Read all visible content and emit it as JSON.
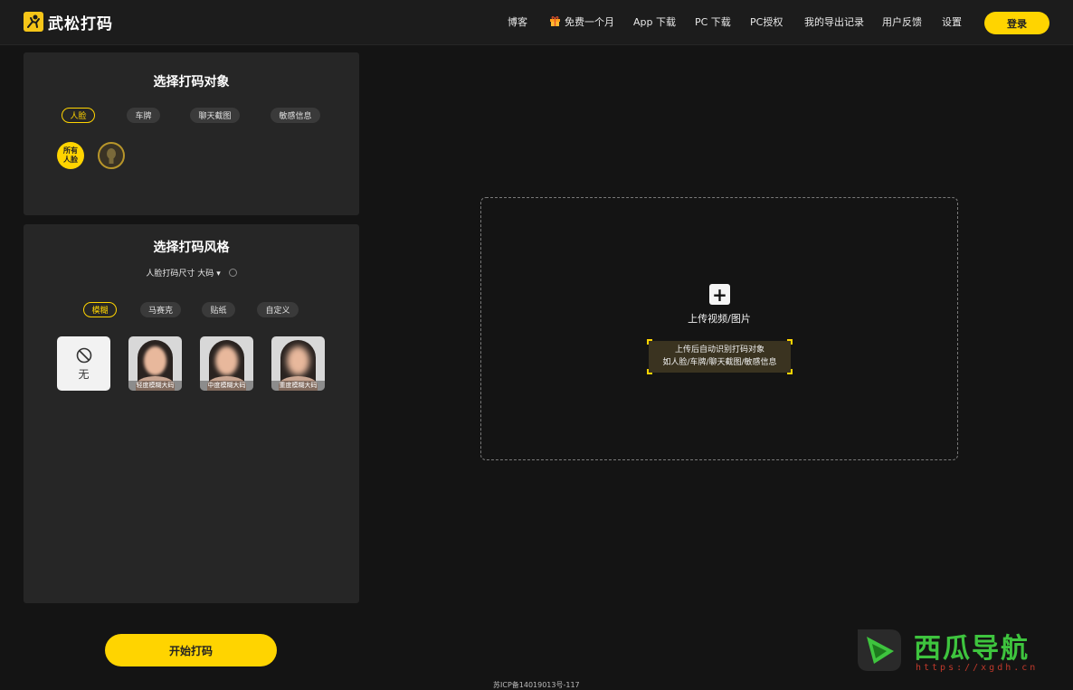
{
  "brand": {
    "name": "武松打码"
  },
  "nav": {
    "items": [
      {
        "label": "博客"
      },
      {
        "label": "免费一个月"
      },
      {
        "label": "App 下载"
      },
      {
        "label": "PC 下载"
      },
      {
        "label": "PC授权"
      },
      {
        "label": "我的导出记录"
      },
      {
        "label": "用户反馈"
      },
      {
        "label": "设置"
      }
    ],
    "login_label": "登录"
  },
  "target_panel": {
    "title": "选择打码对象",
    "tabs": [
      {
        "label": "人脸",
        "active": true
      },
      {
        "label": "车牌",
        "active": false
      },
      {
        "label": "聊天截图",
        "active": false
      },
      {
        "label": "敏感信息",
        "active": false
      }
    ],
    "all_faces_label": "所有人脸"
  },
  "style_panel": {
    "title": "选择打码风格",
    "size_label": "人脸打码尺寸",
    "size_value": "大码",
    "tabs": [
      {
        "label": "模糊",
        "active": true
      },
      {
        "label": "马赛克",
        "active": false
      },
      {
        "label": "贴纸",
        "active": false
      },
      {
        "label": "自定义",
        "active": false
      }
    ],
    "none_label": "无",
    "thumbs": [
      {
        "label": "轻度模糊大码"
      },
      {
        "label": "中度模糊大码"
      },
      {
        "label": "重度模糊大码"
      }
    ]
  },
  "start_button": {
    "label": "开始打码"
  },
  "upload": {
    "label": "上传视频/图片",
    "hint_line1": "上传后自动识别打码对象",
    "hint_line2": "如人脸/车牌/聊天截图/敏感信息"
  },
  "footer": {
    "icp": "苏ICP备14019013号-117"
  },
  "watermark": {
    "title": "西瓜导航",
    "url": "https://xgdh.cn"
  },
  "colors": {
    "accent": "#ffd400",
    "background": "#141414",
    "panel": "#262626"
  }
}
